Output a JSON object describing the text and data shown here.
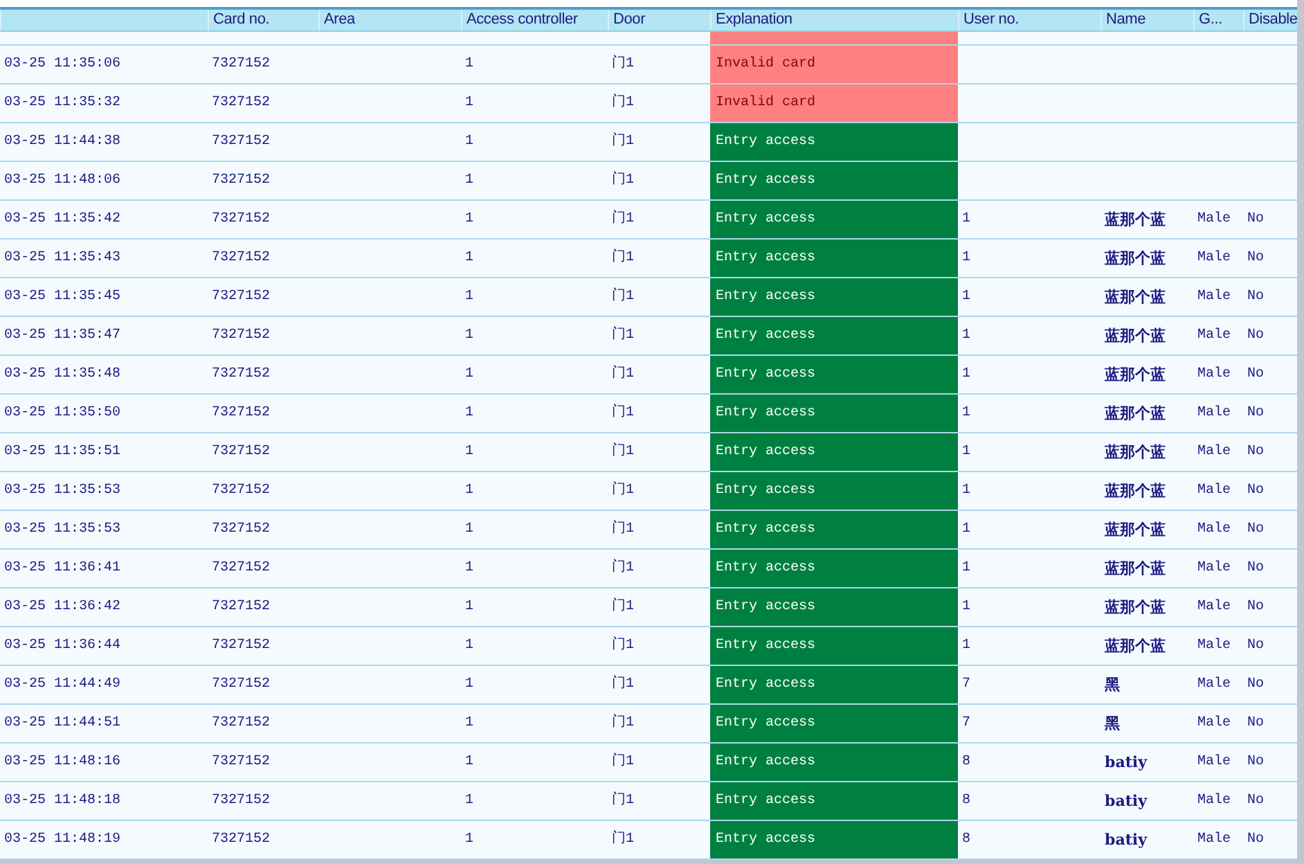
{
  "table": {
    "columns": [
      {
        "label": "Card no."
      },
      {
        "label": "Area"
      },
      {
        "label": "Access controller"
      },
      {
        "label": "Door"
      },
      {
        "label": "Explanation"
      },
      {
        "label": "User no."
      },
      {
        "label": "Name"
      },
      {
        "label": "G..."
      },
      {
        "label": "Disable"
      }
    ],
    "partial_row": {
      "kind": "invalid"
    },
    "rows": [
      {
        "time": "03-25 11:35:06",
        "card": "7327152",
        "controller": "1",
        "door": "门1",
        "explanation": "Invalid card",
        "kind": "invalid"
      },
      {
        "time": "03-25 11:35:32",
        "card": "7327152",
        "controller": "1",
        "door": "门1",
        "explanation": "Invalid card",
        "kind": "invalid"
      },
      {
        "time": "03-25 11:44:38",
        "card": "7327152",
        "controller": "1",
        "door": "门1",
        "explanation": "Entry access",
        "kind": "granted"
      },
      {
        "time": "03-25 11:48:06",
        "card": "7327152",
        "controller": "1",
        "door": "门1",
        "explanation": "Entry access",
        "kind": "granted"
      },
      {
        "time": "03-25 11:35:42",
        "card": "7327152",
        "controller": "1",
        "door": "门1",
        "explanation": "Entry access",
        "kind": "granted",
        "user": "1",
        "name": "蓝那个蓝",
        "gender": "Male",
        "disabled": "No"
      },
      {
        "time": "03-25 11:35:43",
        "card": "7327152",
        "controller": "1",
        "door": "门1",
        "explanation": "Entry access",
        "kind": "granted",
        "user": "1",
        "name": "蓝那个蓝",
        "gender": "Male",
        "disabled": "No"
      },
      {
        "time": "03-25 11:35:45",
        "card": "7327152",
        "controller": "1",
        "door": "门1",
        "explanation": "Entry access",
        "kind": "granted",
        "user": "1",
        "name": "蓝那个蓝",
        "gender": "Male",
        "disabled": "No"
      },
      {
        "time": "03-25 11:35:47",
        "card": "7327152",
        "controller": "1",
        "door": "门1",
        "explanation": "Entry access",
        "kind": "granted",
        "user": "1",
        "name": "蓝那个蓝",
        "gender": "Male",
        "disabled": "No"
      },
      {
        "time": "03-25 11:35:48",
        "card": "7327152",
        "controller": "1",
        "door": "门1",
        "explanation": "Entry access",
        "kind": "granted",
        "user": "1",
        "name": "蓝那个蓝",
        "gender": "Male",
        "disabled": "No"
      },
      {
        "time": "03-25 11:35:50",
        "card": "7327152",
        "controller": "1",
        "door": "门1",
        "explanation": "Entry access",
        "kind": "granted",
        "user": "1",
        "name": "蓝那个蓝",
        "gender": "Male",
        "disabled": "No"
      },
      {
        "time": "03-25 11:35:51",
        "card": "7327152",
        "controller": "1",
        "door": "门1",
        "explanation": "Entry access",
        "kind": "granted",
        "user": "1",
        "name": "蓝那个蓝",
        "gender": "Male",
        "disabled": "No"
      },
      {
        "time": "03-25 11:35:53",
        "card": "7327152",
        "controller": "1",
        "door": "门1",
        "explanation": "Entry access",
        "kind": "granted",
        "user": "1",
        "name": "蓝那个蓝",
        "gender": "Male",
        "disabled": "No"
      },
      {
        "time": "03-25 11:35:53",
        "card": "7327152",
        "controller": "1",
        "door": "门1",
        "explanation": "Entry access",
        "kind": "granted",
        "user": "1",
        "name": "蓝那个蓝",
        "gender": "Male",
        "disabled": "No"
      },
      {
        "time": "03-25 11:36:41",
        "card": "7327152",
        "controller": "1",
        "door": "门1",
        "explanation": "Entry access",
        "kind": "granted",
        "user": "1",
        "name": "蓝那个蓝",
        "gender": "Male",
        "disabled": "No"
      },
      {
        "time": "03-25 11:36:42",
        "card": "7327152",
        "controller": "1",
        "door": "门1",
        "explanation": "Entry access",
        "kind": "granted",
        "user": "1",
        "name": "蓝那个蓝",
        "gender": "Male",
        "disabled": "No"
      },
      {
        "time": "03-25 11:36:44",
        "card": "7327152",
        "controller": "1",
        "door": "门1",
        "explanation": "Entry access",
        "kind": "granted",
        "user": "1",
        "name": "蓝那个蓝",
        "gender": "Male",
        "disabled": "No"
      },
      {
        "time": "03-25 11:44:49",
        "card": "7327152",
        "controller": "1",
        "door": "门1",
        "explanation": "Entry access",
        "kind": "granted",
        "user": "7",
        "name": "黑",
        "gender": "Male",
        "disabled": "No"
      },
      {
        "time": "03-25 11:44:51",
        "card": "7327152",
        "controller": "1",
        "door": "门1",
        "explanation": "Entry access",
        "kind": "granted",
        "user": "7",
        "name": "黑",
        "gender": "Male",
        "disabled": "No"
      },
      {
        "time": "03-25 11:48:16",
        "card": "7327152",
        "controller": "1",
        "door": "门1",
        "explanation": "Entry access",
        "kind": "granted",
        "user": "8",
        "name": "batiy",
        "gender": "Male",
        "disabled": "No"
      },
      {
        "time": "03-25 11:48:18",
        "card": "7327152",
        "controller": "1",
        "door": "门1",
        "explanation": "Entry access",
        "kind": "granted",
        "user": "8",
        "name": "batiy",
        "gender": "Male",
        "disabled": "No"
      },
      {
        "time": "03-25 11:48:19",
        "card": "7327152",
        "controller": "1",
        "door": "门1",
        "explanation": "Entry access",
        "kind": "granted",
        "user": "8",
        "name": "batiy",
        "gender": "Male",
        "disabled": "No"
      }
    ]
  }
}
